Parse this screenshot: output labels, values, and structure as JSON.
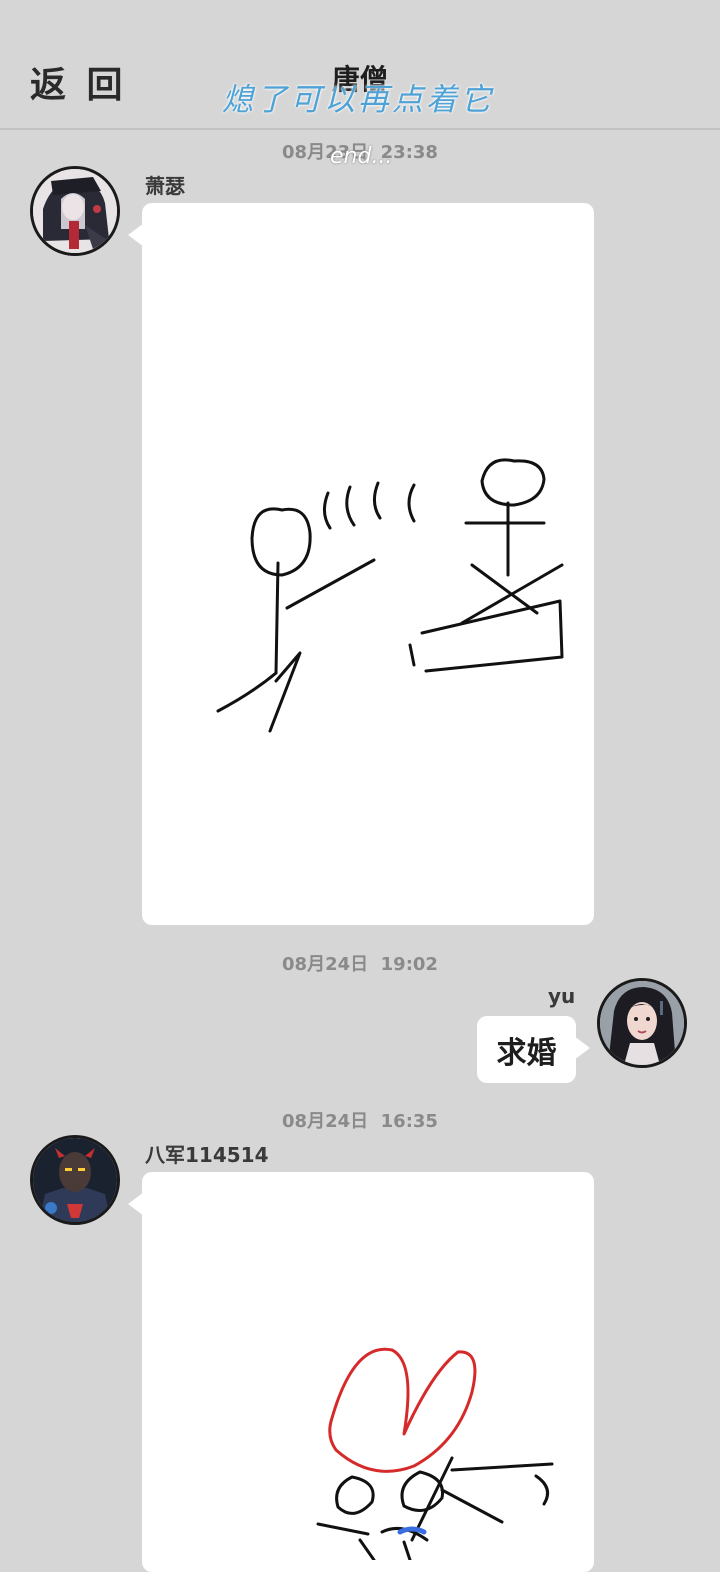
{
  "header": {
    "back_label": "返 回",
    "title": "唐僧",
    "overlay_caption": "熄了可以再点着它",
    "overlay_end": "end..."
  },
  "messages": [
    {
      "timestamp": "08月23日  23:38",
      "sender": "萧瑟",
      "side": "left",
      "type": "drawing",
      "avatar_icon": "anime-girl-avatar"
    },
    {
      "timestamp": "08月24日  19:02",
      "sender": "yu",
      "side": "right",
      "type": "text",
      "text": "求婚",
      "avatar_icon": "woman-portrait-avatar"
    },
    {
      "timestamp": "08月24日  16:35",
      "sender": "八军114514",
      "side": "left",
      "type": "drawing",
      "avatar_icon": "dark-warrior-avatar"
    }
  ],
  "colors": {
    "background": "#d6d6d6",
    "bubble": "#ffffff",
    "caption": "#4ea2d6",
    "sketch_red": "#d62a2a"
  }
}
